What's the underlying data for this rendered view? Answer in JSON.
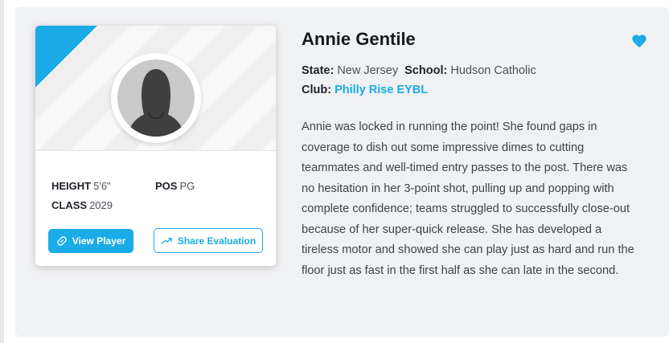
{
  "player": {
    "name": "Annie Gentile",
    "state_label": "State:",
    "state": "New Jersey",
    "school_label": "School:",
    "school": "Hudson Catholic",
    "club_label": "Club:",
    "club": "Philly Rise EYBL",
    "height_label": "HEIGHT",
    "height": "5'6\"",
    "pos_label": "POS",
    "pos": "PG",
    "class_label": "CLASS",
    "class_year": "2029",
    "evaluation": "Annie was locked in running the point! She found gaps in coverage to dish out some impressive dimes to cutting teammates and well-timed entry passes to the post. There was no hesitation in her 3-point shot, pulling up and popping with complete confidence; teams struggled to successfully close-out because of her super-quick release. She has developed a tireless motor and showed she can play just as hard and run the floor just as fast in the first half as she can late in the second."
  },
  "actions": {
    "view_player": "View Player",
    "share_evaluation": "Share Evaluation"
  },
  "icons": {
    "favorite": "heart-icon",
    "view": "link-icon",
    "share": "trend-arrow-icon",
    "avatar": "user-silhouette-icon"
  },
  "colors": {
    "accent": "#1aabe8",
    "panel_bg": "#f0f1f3",
    "text_dark": "#16191d"
  }
}
